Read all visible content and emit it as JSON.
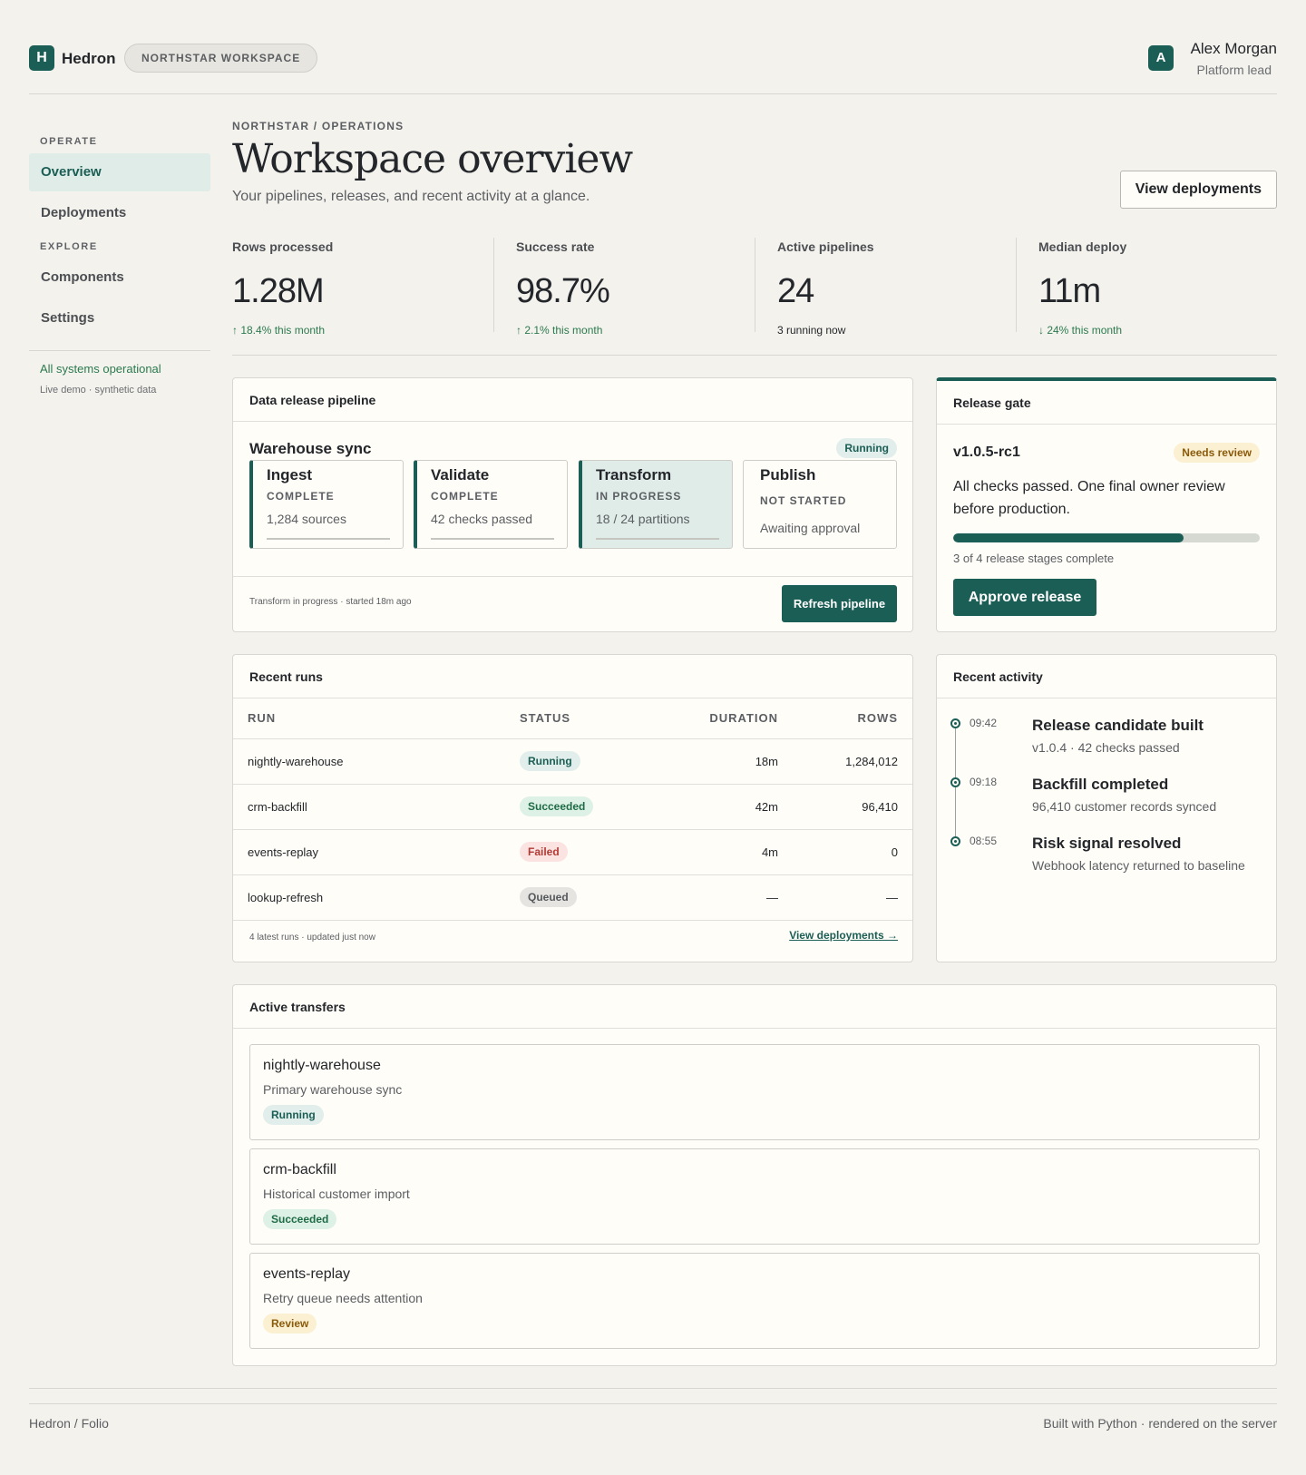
{
  "header": {
    "brand_initial": "H",
    "brand_name": "Hedron",
    "workspace": "NORTHSTAR WORKSPACE",
    "user_initial": "A",
    "user_name": "Alex Morgan",
    "user_role": "Platform lead"
  },
  "sidebar": {
    "section_operate": "OPERATE",
    "section_explore": "EXPLORE",
    "items": [
      {
        "label": "Overview",
        "active": true
      },
      {
        "label": "Deployments",
        "active": false
      },
      {
        "label": "Components",
        "active": false
      },
      {
        "label": "Settings",
        "active": false
      }
    ],
    "status": "All systems operational",
    "note": "Live demo · synthetic data"
  },
  "page": {
    "breadcrumb": "NORTHSTAR / OPERATIONS",
    "title": "Workspace overview",
    "subtitle": "Your pipelines, releases, and recent activity at a glance.",
    "view_deployments": "View deployments"
  },
  "stats": [
    {
      "label": "Rows processed",
      "value": "1.28M",
      "delta": "↑ 18.4% this month"
    },
    {
      "label": "Success rate",
      "value": "98.7%",
      "delta": "↑ 2.1% this month"
    },
    {
      "label": "Active pipelines",
      "value": "24",
      "delta": "3 running now"
    },
    {
      "label": "Median deploy",
      "value": "11m",
      "delta": "↓ 24% this month"
    }
  ],
  "pipeline": {
    "card_title": "Data release pipeline",
    "name": "Warehouse sync",
    "status": "Running",
    "stages": [
      {
        "name": "Ingest",
        "state": "COMPLETE",
        "detail": "1,284 sources"
      },
      {
        "name": "Validate",
        "state": "COMPLETE",
        "detail": "42 checks passed"
      },
      {
        "name": "Transform",
        "state": "IN PROGRESS",
        "detail": "18 / 24 partitions"
      },
      {
        "name": "Publish",
        "state": "NOT STARTED",
        "detail": "Awaiting approval"
      }
    ],
    "footer": "Transform in progress · started 18m ago",
    "refresh": "Refresh pipeline"
  },
  "gate": {
    "card_title": "Release gate",
    "version": "v1.0.5-rc1",
    "badge": "Needs review",
    "description": "All checks passed. One final owner review before production.",
    "progress": 0.75,
    "progress_text": "3 of 4 release stages complete",
    "approve": "Approve release"
  },
  "runs": {
    "card_title": "Recent runs",
    "columns": [
      "RUN",
      "STATUS",
      "DURATION",
      "ROWS"
    ],
    "rows": [
      {
        "run": "nightly-warehouse",
        "status": "Running",
        "duration": "18m",
        "rows": "1,284,012"
      },
      {
        "run": "crm-backfill",
        "status": "Succeeded",
        "duration": "42m",
        "rows": "96,410"
      },
      {
        "run": "events-replay",
        "status": "Failed",
        "duration": "4m",
        "rows": "0"
      },
      {
        "run": "lookup-refresh",
        "status": "Queued",
        "duration": "—",
        "rows": "—"
      }
    ],
    "footer": "4 latest runs · updated just now",
    "link": "View deployments →"
  },
  "activity": {
    "card_title": "Recent activity",
    "items": [
      {
        "time": "09:42",
        "title": "Release candidate built",
        "sub": "v1.0.4 · 42 checks passed"
      },
      {
        "time": "09:18",
        "title": "Backfill completed",
        "sub": "96,410 customer records synced"
      },
      {
        "time": "08:55",
        "title": "Risk signal resolved",
        "sub": "Webhook latency returned to baseline"
      }
    ]
  },
  "transfers": {
    "card_title": "Active transfers",
    "items": [
      {
        "name": "nightly-warehouse",
        "desc": "Primary warehouse sync",
        "status": "Running"
      },
      {
        "name": "crm-backfill",
        "desc": "Historical customer import",
        "status": "Succeeded"
      },
      {
        "name": "events-replay",
        "desc": "Retry queue needs attention",
        "status": "Review"
      }
    ]
  },
  "footer": {
    "left": "Hedron / Folio",
    "right": "Built with Python · rendered on the server"
  },
  "colors": {
    "accent": "#1b5e55",
    "background": "#f4f2ed",
    "success": "#2b7a4f",
    "danger": "#b33b35",
    "warning": "#8a5a0b"
  }
}
